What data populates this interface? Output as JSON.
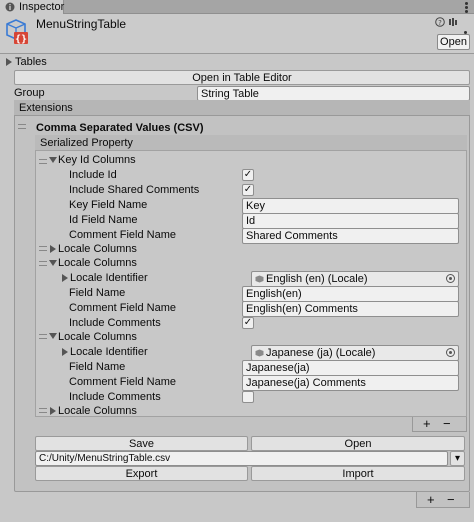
{
  "tab": {
    "label": "Inspector"
  },
  "header": {
    "title": "MenuStringTable",
    "open_label": "Open"
  },
  "tables": {
    "label": "Tables",
    "open_editor_label": "Open in Table Editor"
  },
  "group": {
    "label": "Group",
    "value": "String Table"
  },
  "extensions": {
    "label": "Extensions",
    "csv_title": "Comma Separated Values (CSV)",
    "serialized_label": "Serialized Property",
    "key_id_columns": {
      "label": "Key Id Columns",
      "include_id": {
        "label": "Include Id",
        "checked": true
      },
      "include_shared": {
        "label": "Include Shared Comments",
        "checked": true
      },
      "key_field": {
        "label": "Key Field Name",
        "value": "Key"
      },
      "id_field": {
        "label": "Id Field Name",
        "value": "Id"
      },
      "comment_field": {
        "label": "Comment Field Name",
        "value": "Shared Comments"
      }
    },
    "locale_columns_label": "Locale Columns",
    "locale_en": {
      "identifier_label": "Locale Identifier",
      "identifier_value": "English (en) (Locale)",
      "field_label": "Field Name",
      "field_value": "English(en)",
      "comment_label": "Comment Field Name",
      "comment_value": "English(en) Comments",
      "include_comments_label": "Include Comments",
      "include_comments": true
    },
    "locale_ja": {
      "identifier_label": "Locale Identifier",
      "identifier_value": "Japanese (ja) (Locale)",
      "field_label": "Field Name",
      "field_value": "Japanese(ja)",
      "comment_label": "Comment Field Name",
      "comment_value": "Japanese(ja) Comments",
      "include_comments_label": "Include Comments",
      "include_comments": false
    },
    "save_label": "Save",
    "open_label": "Open",
    "path_value": "C:/Unity/MenuStringTable.csv",
    "export_label": "Export",
    "import_label": "Import",
    "plus_symbol": "+",
    "minus_symbol": "−",
    "dropdown_symbol": "▾",
    "check_symbol": "✓"
  }
}
